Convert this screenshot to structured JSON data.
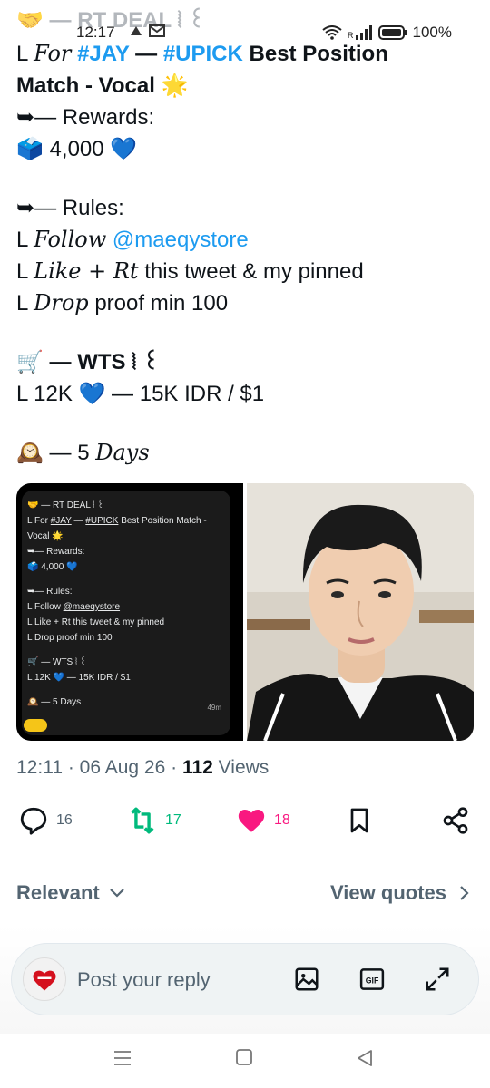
{
  "status_bar": {
    "ghost_title": "🤝 — RT DEAL ⦚ ꒰ ",
    "time": "12:17",
    "battery": "100%",
    "colors": {
      "text": "#222222"
    }
  },
  "tweet": {
    "line1_prefix": "L ",
    "line1_script": "For",
    "line1_tag1": "#JAY",
    "line1_dash": " — ",
    "line1_tag2": "#UPICK",
    "line1_rest": " Best Position",
    "line2": "Match - Vocal 🌟",
    "rewards_label": "➥— Rewards:",
    "rewards_value": "🗳️ 4,000 💙",
    "rules_label": "➥— Rules:",
    "rule1_prefix": "L ",
    "rule1_script": "Follow",
    "rule1_handle": " @maeqystore",
    "rule2_prefix": "L ",
    "rule2_script": "Like + Rt",
    "rule2_rest": " this tweet & my pinned",
    "rule3_prefix": "L ",
    "rule3_script": "Drop",
    "rule3_rest": " proof min 100",
    "wts_label": "🛒 — WTS ⦚ ꒰",
    "wts_value": "L 12K 💙 — 15K IDR / $1",
    "days_prefix": "🕰️ — 5 ",
    "days_script": "Days"
  },
  "media": {
    "mini": {
      "l1": "🤝 — RT DEAL ⦚ ꒰",
      "l2a": "L For ",
      "l2b": "#JAY",
      "l2c": " — ",
      "l2d": "#UPICK",
      "l2e": " Best Position Match -",
      "l3": "Vocal 🌟",
      "l4": "➥— Rewards:",
      "l5": "🗳️ 4,000 💙",
      "l6": "➥— Rules:",
      "l7a": "L Follow ",
      "l7b": "@maeqystore",
      "l8": "L Like + Rt this tweet & my pinned",
      "l9": "L Drop proof min 100",
      "l10": "🛒 — WTS ⦚ ꒰",
      "l11": "L 12K 💙 — 15K IDR / $1",
      "l12": "🕰️ — 5 Days",
      "time": "49m"
    }
  },
  "meta": {
    "time": "12:11",
    "date": "06 Aug 26",
    "views_count": "112",
    "views_label": " Views"
  },
  "actions": {
    "replies": "16",
    "retweets": "17",
    "likes": "18",
    "colors": {
      "retweet": "#00ba7c",
      "like": "#f91880",
      "default": "#536471"
    }
  },
  "filters": {
    "relevant": "Relevant",
    "view_quotes": "View quotes"
  },
  "reply": {
    "placeholder": "Post your reply"
  }
}
